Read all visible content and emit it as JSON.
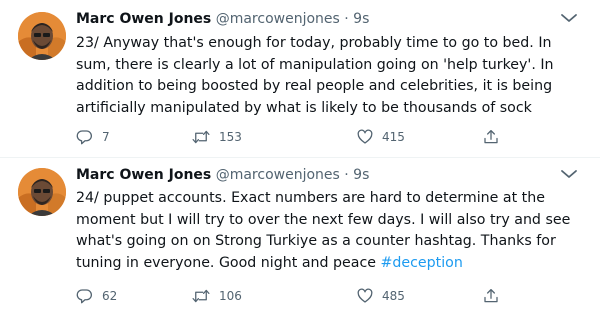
{
  "tweets": [
    {
      "name": "Marc Owen Jones",
      "handle": "@marcowenjones",
      "dot": "·",
      "time": "9s",
      "text": "23/ Anyway that's enough for today, probably time to go to bed. In sum, there is clearly a lot of manipulation going on 'help turkey'. In addition to being boosted by real people and celebrities, it is being artificially manipulated by what is likely to be thousands of sock",
      "hashtag": "",
      "replies": "7",
      "retweets": "153",
      "likes": "415"
    },
    {
      "name": "Marc Owen Jones",
      "handle": "@marcowenjones",
      "dot": "·",
      "time": "9s",
      "text": "24/ puppet accounts. Exact numbers are hard to determine at the moment but I will try to over the next few days. I will also try and see what's going on on Strong Turkiye as a counter hashtag. Thanks for tuning in everyone. Good night and peace ",
      "hashtag": "#deception",
      "replies": "62",
      "retweets": "106",
      "likes": "485"
    }
  ],
  "icons": {
    "more": "more-chevron-icon",
    "reply": "reply-icon",
    "retweet": "retweet-icon",
    "like": "heart-icon",
    "share": "share-icon"
  },
  "colors": {
    "text": "#0f1419",
    "secondary": "#536471",
    "link": "#1d9bf0",
    "divider": "#eff3f4"
  }
}
